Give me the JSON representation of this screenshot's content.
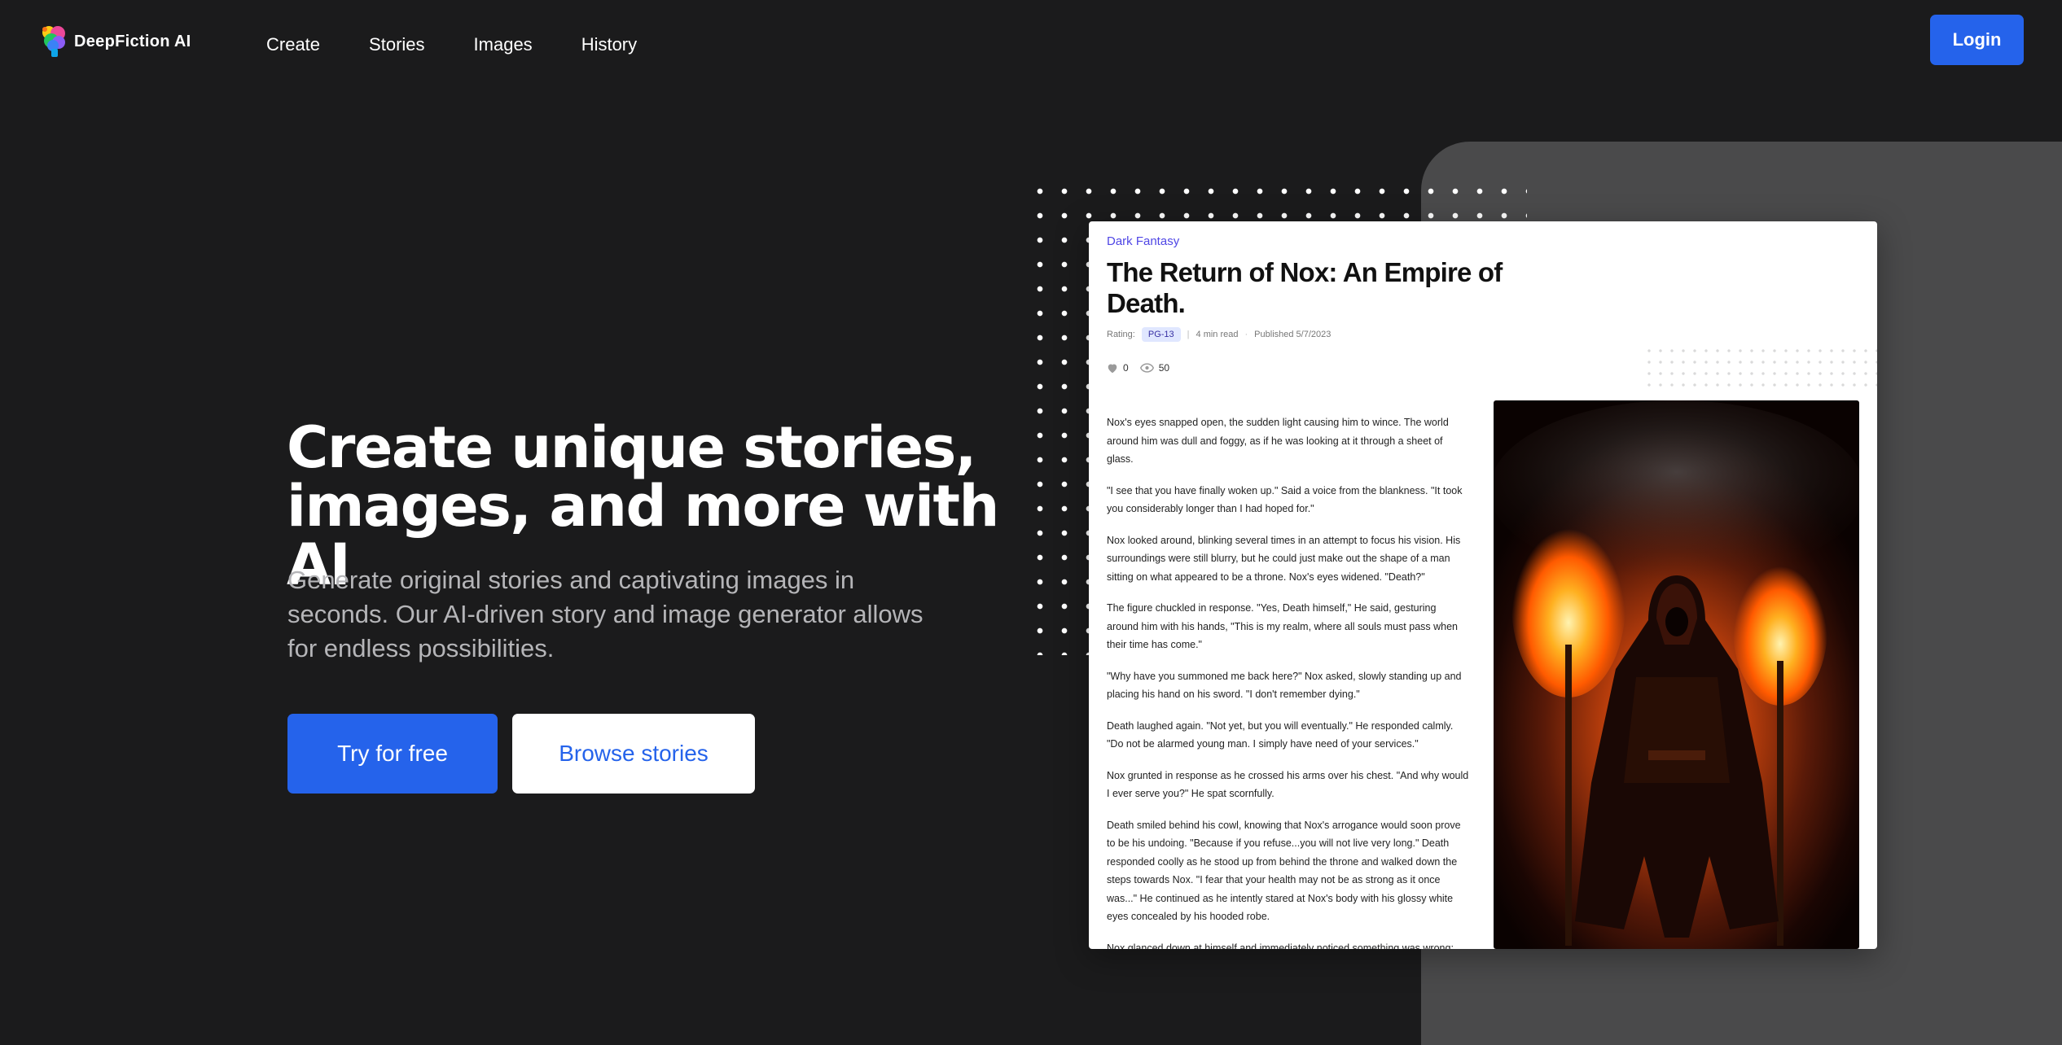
{
  "brand": {
    "name": "DeepFiction AI"
  },
  "nav": {
    "items": [
      "Create",
      "Stories",
      "Images",
      "History"
    ],
    "login": "Login"
  },
  "hero": {
    "title_line1": "Create unique stories,",
    "title_line2": "images, and more with AI",
    "subtitle": "Generate original stories and captivating images in seconds. Our AI-driven story and image generator allows for endless possibilities.",
    "primary_cta": "Try for free",
    "secondary_cta": "Browse stories"
  },
  "story": {
    "genre": "Dark Fantasy",
    "title": "The Return of Nox: An Empire of Death.",
    "rating_label": "Rating:",
    "rating": "PG-13",
    "read_time": "4 min read",
    "published": "Published 5/7/2023",
    "likes": "0",
    "views": "50",
    "paragraphs": [
      "Nox's eyes snapped open, the sudden light causing him to wince. The world around him was dull and foggy, as if he was looking at it through a sheet of glass.",
      "\"I see that you have finally woken up.\" Said a voice from the blankness. \"It took you considerably longer than I had hoped for.\"",
      "Nox looked around, blinking several times in an attempt to focus his vision. His surroundings were still blurry, but he could just make out the shape of a man sitting on what appeared to be a throne. Nox's eyes widened. \"Death?\"",
      "The figure chuckled in response. \"Yes, Death himself,\" He said, gesturing around him with his hands, \"This is my realm, where all souls must pass when their time has come.\"",
      "\"Why have you summoned me back here?\" Nox asked, slowly standing up and placing his hand on his sword. \"I don't remember dying.\"",
      "Death laughed again. \"Not yet, but you will eventually.\" He responded calmly. \"Do not be alarmed young man. I simply have need of your services.\"",
      "Nox grunted in response as he crossed his arms over his chest. \"And why would I ever serve you?\" He spat scornfully.",
      "Death smiled behind his cowl, knowing that Nox's arrogance would soon prove to be his undoing. \"Because if you refuse...you will not live very long.\" Death responded coolly as he stood up from behind the throne and walked down the steps towards Nox. \"I fear that your health may not be as strong as it once was...\" He continued as he intently stared at Nox's body with his glossy white eyes concealed by his hooded robe.",
      "Nox glanced down at himself and immediately noticed something was wrong;"
    ]
  },
  "colors": {
    "background": "#1b1b1c",
    "accent": "#2563eb",
    "panel": "#4a4a4b"
  },
  "icons": {
    "logo": "brain-logo-icon",
    "likes": "heart-icon",
    "views": "eye-icon"
  }
}
